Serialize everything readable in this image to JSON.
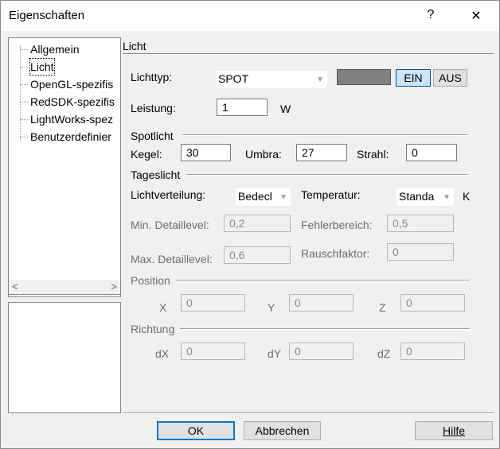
{
  "window": {
    "title": "Eigenschaften",
    "help_glyph": "?",
    "close_glyph": "✕"
  },
  "tree": {
    "items": [
      {
        "label": "Allgemein"
      },
      {
        "label": "Licht"
      },
      {
        "label": "OpenGL-spezifis"
      },
      {
        "label": "RedSDK-spezifis"
      },
      {
        "label": "LightWorks-spez"
      },
      {
        "label": "Benutzerdefinier"
      }
    ],
    "selected": "Licht",
    "scroll_left": "<",
    "scroll_right": ">"
  },
  "panel": {
    "title": "Licht",
    "lichttyp": {
      "label": "Lichttyp:",
      "value": "SPOT"
    },
    "color_swatch": "#808080",
    "ein_label": "EIN",
    "aus_label": "AUS",
    "leistung": {
      "label": "Leistung:",
      "value": "1",
      "unit": "W"
    },
    "spotlicht": {
      "title": "Spotlicht",
      "kegel_label": "Kegel:",
      "kegel_value": "30",
      "umbra_label": "Umbra:",
      "umbra_value": "27",
      "strahl_label": "Strahl:",
      "strahl_value": "0"
    },
    "tageslicht": {
      "title": "Tageslicht",
      "lichtverteilung_label": "Lichtverteilung:",
      "lichtverteilung_value": "Bedecl",
      "temperatur_label": "Temperatur:",
      "temperatur_value": "Standa",
      "temperatur_unit": "K",
      "min_label": "Min. Detaillevel:",
      "min_value": "0,2",
      "fehler_label": "Fehlerbereich:",
      "fehler_value": "0,5",
      "max_label": "Max. Detaillevel:",
      "max_value": "0,6",
      "rausch_label": "Rauschfaktor:",
      "rausch_value": "0"
    },
    "position": {
      "title": "Position",
      "x_label": "X",
      "x_value": "0",
      "y_label": "Y",
      "y_value": "0",
      "z_label": "Z",
      "z_value": "0"
    },
    "richtung": {
      "title": "Richtung",
      "dx_label": "dX",
      "dx_value": "0",
      "dy_label": "dY",
      "dy_value": "0",
      "dz_label": "dZ",
      "dz_value": "0"
    }
  },
  "buttons": {
    "ok": "OK",
    "cancel": "Abbrechen",
    "help": "Hilfe"
  }
}
